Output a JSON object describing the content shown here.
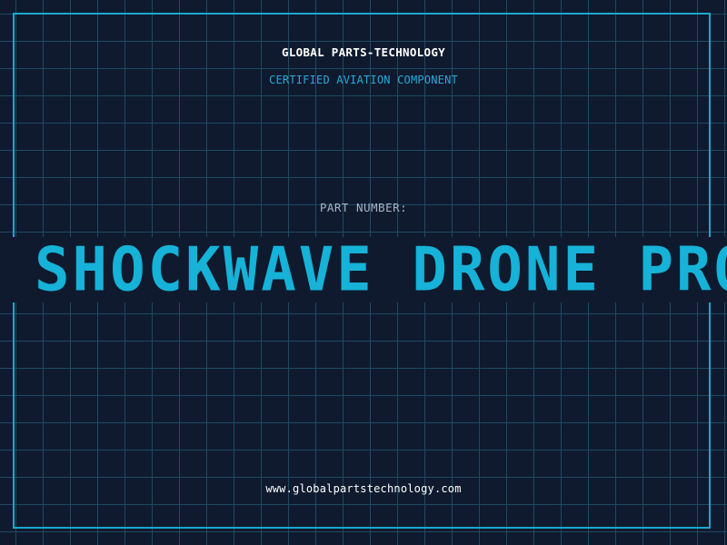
{
  "brand": {
    "name": "GLOBAL PARTS-TECHNOLOGY",
    "tagline": "CERTIFIED AVIATION COMPONENT"
  },
  "part": {
    "label": "PART NUMBER:",
    "name": "SHOCKWAVE DRONE PROPELLER"
  },
  "footer": {
    "website": "www.globalpartstechnology.com"
  },
  "colors": {
    "background": "#0f1a2e",
    "grid": "#1d4a62",
    "accent": "#1ba8cf",
    "text_primary": "#ffffff",
    "text_muted": "#a7b3c4"
  }
}
